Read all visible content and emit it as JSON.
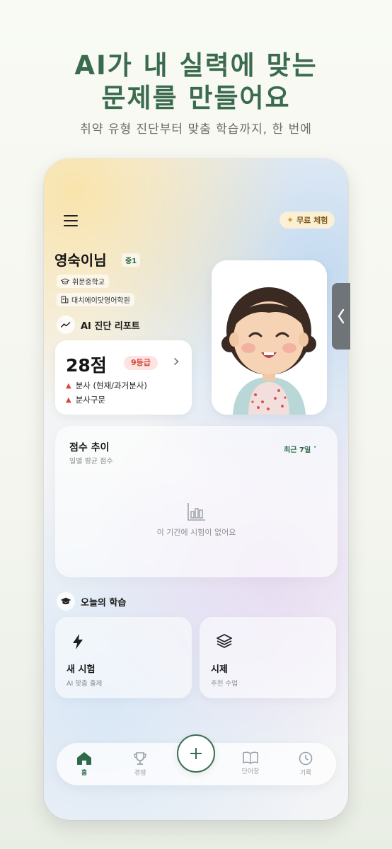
{
  "promo": {
    "headline_line1": "AI가 내 실력에 맞는",
    "headline_line2": "문제를 만들어요",
    "subheadline": "취약 유형 진단부터 맞춤 학습까지, 한 번에"
  },
  "header": {
    "menu_icon": "hamburger-menu-icon",
    "trial_button_label": "무료 체험",
    "trial_icon": "sparkle-icon"
  },
  "profile": {
    "name": "영숙이님",
    "grade": "중1",
    "school": "휘문중학교",
    "academy": "대치에이닷영어학원",
    "school_icon": "graduation-cap-icon",
    "academy_icon": "building-icon"
  },
  "diagnosis": {
    "section_title": "AI 진단 리포트",
    "section_icon": "trend-line-icon",
    "score": "28점",
    "grade_badge": "9등급",
    "weak_areas": [
      "분사 (현재/과거분사)",
      "분사구문"
    ]
  },
  "score_trend": {
    "title": "점수 추이",
    "subtitle": "일별 평균 점수",
    "period": "최근 7일",
    "empty_message": "이 기간에 시험이 없어요"
  },
  "today_learning": {
    "section_title": "오늘의 학습",
    "section_icon": "graduation-cap-icon",
    "cards": [
      {
        "title": "새 시험",
        "subtitle": "AI 맞춤 출제",
        "icon": "lightning-bolt-icon"
      },
      {
        "title": "시제",
        "subtitle": "추천 수업",
        "icon": "layers-icon"
      }
    ]
  },
  "bottom_nav": {
    "items": [
      {
        "label": "홈",
        "icon": "home-icon",
        "active": true
      },
      {
        "label": "경쟁",
        "icon": "trophy-icon",
        "active": false
      },
      {
        "label": "단어장",
        "icon": "book-icon",
        "active": false
      },
      {
        "label": "기록",
        "icon": "clock-icon",
        "active": false
      }
    ],
    "fab_icon": "plus-icon"
  },
  "colors": {
    "brand_green": "#3a6b4e",
    "danger_red": "#d44a3c",
    "trial_bg": "#fbf0d6"
  }
}
